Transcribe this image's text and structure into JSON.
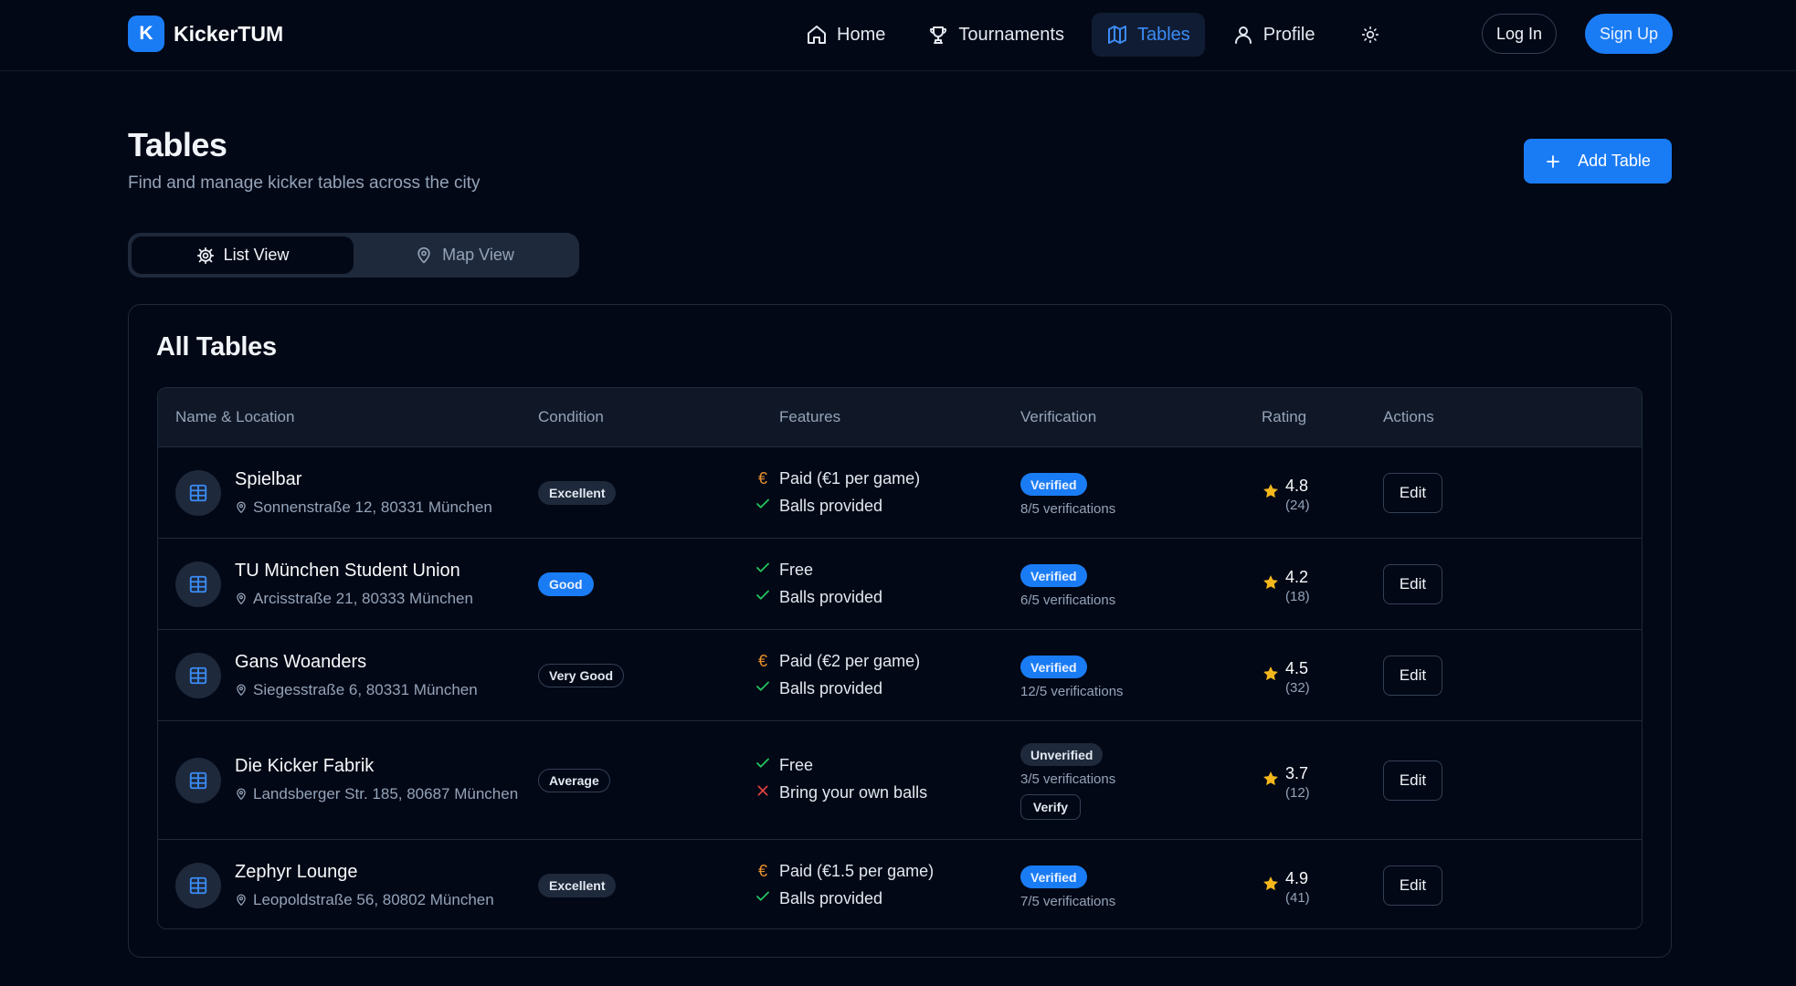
{
  "app": {
    "logo_letter": "K",
    "name": "KickerTUM"
  },
  "nav": {
    "items": [
      {
        "label": "Home",
        "icon": "home-icon"
      },
      {
        "label": "Tournaments",
        "icon": "trophy-icon"
      },
      {
        "label": "Tables",
        "icon": "map-icon",
        "active": true
      },
      {
        "label": "Profile",
        "icon": "user-icon"
      }
    ],
    "theme_icon": "sun-icon",
    "login": "Log In",
    "signup": "Sign Up"
  },
  "page": {
    "title": "Tables",
    "subtitle": "Find and manage kicker tables across the city",
    "add_button": "Add Table"
  },
  "view_toggle": {
    "list": "List View",
    "map": "Map View",
    "active": "list"
  },
  "card": {
    "title": "All Tables"
  },
  "table": {
    "columns": [
      "Name & Location",
      "Condition",
      "Features",
      "Verification",
      "Rating",
      "Actions"
    ],
    "rows": [
      {
        "name": "Spielbar",
        "address": "Sonnenstraße 12, 80331 München",
        "condition": "Excellent",
        "features": [
          {
            "icon": "euro",
            "text": "Paid (€1 per game)"
          },
          {
            "icon": "check",
            "text": "Balls provided"
          }
        ],
        "verification": {
          "status": "Verified",
          "count": "8/5 verifications"
        },
        "rating": "4.8",
        "rating_count": "(24)",
        "action": "Edit"
      },
      {
        "name": "TU München Student Union",
        "address": "Arcisstraße 21, 80333 München",
        "condition": "Good",
        "features": [
          {
            "icon": "check",
            "text": "Free"
          },
          {
            "icon": "check",
            "text": "Balls provided"
          }
        ],
        "verification": {
          "status": "Verified",
          "count": "6/5 verifications"
        },
        "rating": "4.2",
        "rating_count": "(18)",
        "action": "Edit"
      },
      {
        "name": "Gans Woanders",
        "address": "Siegesstraße 6, 80331 München",
        "condition": "Very Good",
        "features": [
          {
            "icon": "euro",
            "text": "Paid (€2 per game)"
          },
          {
            "icon": "check",
            "text": "Balls provided"
          }
        ],
        "verification": {
          "status": "Verified",
          "count": "12/5 verifications"
        },
        "rating": "4.5",
        "rating_count": "(32)",
        "action": "Edit"
      },
      {
        "name": "Die Kicker Fabrik",
        "address": "Landsberger Str. 185, 80687 München",
        "condition": "Average",
        "features": [
          {
            "icon": "check",
            "text": "Free"
          },
          {
            "icon": "x",
            "text": "Bring your own balls"
          }
        ],
        "verification": {
          "status": "Unverified",
          "count": "3/5 verifications",
          "verify_button": "Verify"
        },
        "rating": "3.7",
        "rating_count": "(12)",
        "action": "Edit"
      },
      {
        "name": "Zephyr Lounge",
        "address": "Leopoldstraße 56, 80802 München",
        "condition": "Excellent",
        "features": [
          {
            "icon": "euro",
            "text": "Paid (€1.5 per game)"
          },
          {
            "icon": "check",
            "text": "Balls provided"
          }
        ],
        "verification": {
          "status": "Verified",
          "count": "7/5 verifications"
        },
        "rating": "4.9",
        "rating_count": "(41)",
        "action": "Edit"
      }
    ]
  },
  "colors": {
    "background": "#030816",
    "accent": "#1a7cf5",
    "star": "#f5b81c",
    "euro": "#e8912b",
    "check": "#22c55e",
    "cross": "#ef4444"
  }
}
